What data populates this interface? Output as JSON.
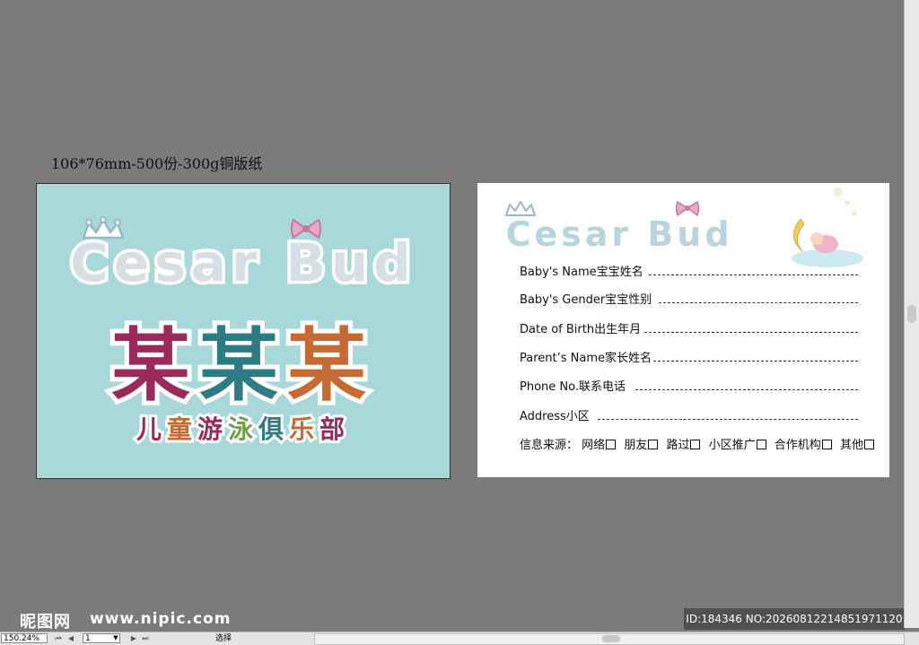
{
  "document": {
    "title": "106*76mm-500份-300g铜版纸"
  },
  "front": {
    "brand": "Cesar Bud",
    "name_chars": [
      "某",
      "某",
      "某"
    ],
    "subtitle_chars": [
      "儿",
      "童",
      "游",
      "泳",
      "俱",
      "乐",
      "部"
    ],
    "subtitle_colors": [
      "#9b2a5c",
      "#c56a33",
      "#9b2a5c",
      "#6fa04a",
      "#2d7c84",
      "#c56a33",
      "#9b2a5c"
    ]
  },
  "back": {
    "brand": "Cesar Bud",
    "fields": [
      "Baby's Name宝宝姓名",
      "Baby's Gender宝宝性别",
      "Date of Birth出生年月",
      "Parent’s Name家长姓名",
      "Phone No.联系电话",
      "Address小区"
    ],
    "source_label": "信息来源：",
    "source_options": [
      "网络",
      "朋友",
      "路过",
      "小区推广",
      "合作机构",
      "其他"
    ]
  },
  "watermark": {
    "logo": "昵图网",
    "site": "www.nipic.com",
    "id_text": "ID:184346 NO:20260812214851971120"
  },
  "statusbar": {
    "zoom": "150.24%",
    "page": "1",
    "status": "选择"
  },
  "colors": {
    "front_bg": "#a8d8d9",
    "purple": "#9b2a5c",
    "teal": "#2d7c84",
    "orange": "#c56a33",
    "green": "#6fa04a",
    "pink": "#e6a9c6",
    "canvas": "#7b7b7b"
  }
}
